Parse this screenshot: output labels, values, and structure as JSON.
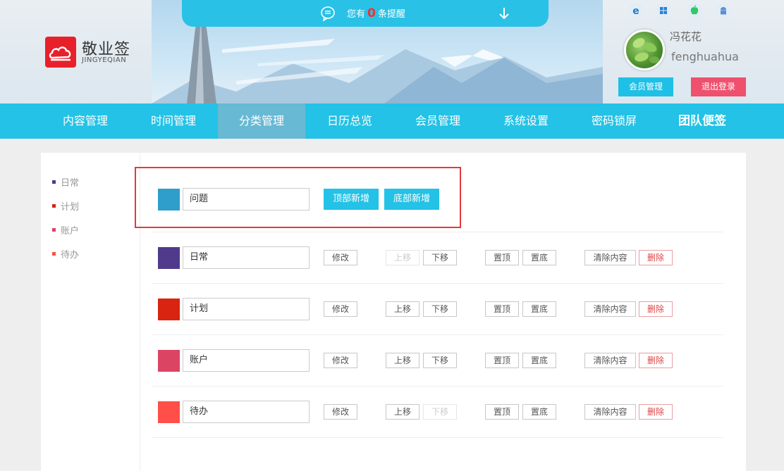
{
  "header": {
    "notice_prefix": "您有",
    "notice_count": "0",
    "notice_suffix": "条提醒",
    "brand_name": "敬业签",
    "brand_sub": "JINGYEQIAN",
    "os_icons": [
      "ie-icon",
      "windows-icon",
      "apple-icon",
      "android-icon"
    ],
    "user_name": "冯花花",
    "user_id": "fenghuahua",
    "member_btn": "会员管理",
    "logout_btn": "退出登录"
  },
  "nav": {
    "items": [
      "内容管理",
      "时间管理",
      "分类管理",
      "日历总览",
      "会员管理",
      "系统设置",
      "密码锁屏",
      "团队便签"
    ],
    "active": "分类管理"
  },
  "sidebar": {
    "items": [
      {
        "label": "日常",
        "color": "#4f3a8c"
      },
      {
        "label": "计划",
        "color": "#d82410"
      },
      {
        "label": "账户",
        "color": "#dc4464"
      },
      {
        "label": "待办",
        "color": "#ff4f48"
      }
    ]
  },
  "add_row": {
    "swatch_color": "#2f9ecb",
    "value": "问题",
    "top_add": "顶部新增",
    "bottom_add": "底部新增"
  },
  "buttons": {
    "edit": "修改",
    "up": "上移",
    "down": "下移",
    "top": "置顶",
    "bottom": "置底",
    "clear": "清除内容",
    "delete": "删除"
  },
  "rows": [
    {
      "value": "日常",
      "color": "#4f3a8c",
      "up_disabled": true,
      "down_disabled": false
    },
    {
      "value": "计划",
      "color": "#d82410",
      "up_disabled": false,
      "down_disabled": false
    },
    {
      "value": "账户",
      "color": "#dc4464",
      "up_disabled": false,
      "down_disabled": false
    },
    {
      "value": "待办",
      "color": "#ff4f48",
      "up_disabled": false,
      "down_disabled": true
    }
  ],
  "colors": {
    "accent": "#23c2e6",
    "logout": "#ee506e",
    "logo": "#e8202a",
    "highlight": "#e8373c"
  }
}
